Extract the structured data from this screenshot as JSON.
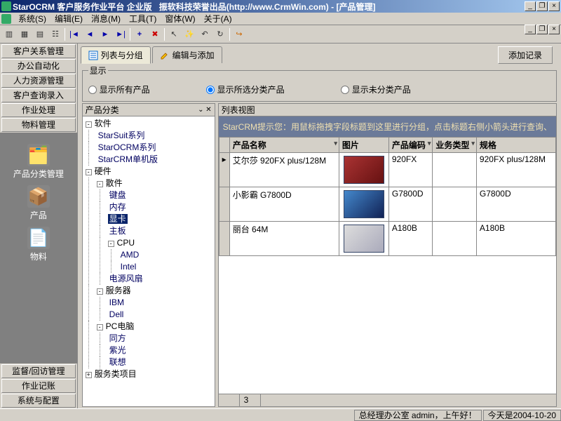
{
  "titlebar": {
    "app": "StarOCRM 客户服务作业平台 企业版",
    "vendor": "振软科技荣誉出品(http://www.CrmWin.com)",
    "doc": "[产品管理]"
  },
  "menus": [
    "系统(S)",
    "编辑(E)",
    "消息(M)",
    "工具(T)",
    "窗体(W)",
    "关于(A)"
  ],
  "sidebar": {
    "top": [
      "客户关系管理",
      "办公自动化",
      "人力资源管理",
      "客户查询录入",
      "作业处理",
      "物料管理"
    ],
    "icons": [
      {
        "label": "产品分类管理",
        "emoji": "🗂️"
      },
      {
        "label": "产品",
        "emoji": "📦"
      },
      {
        "label": "物料",
        "emoji": "📄"
      }
    ],
    "bottom": [
      "监督/回访管理",
      "作业记账",
      "系统与配置"
    ]
  },
  "tabs": {
    "list": "列表与分组",
    "edit": "编辑与添加",
    "add_record": "添加记录"
  },
  "filter": {
    "legend": "显示",
    "all": "显示所有产品",
    "sel": "显示所选分类产品",
    "unsel": "显示未分类产品"
  },
  "tree": {
    "header": "产品分类",
    "nodes": {
      "soft": "软件",
      "starsuit": "StarSuit系列",
      "starocrm": "StarOCRM系列",
      "starcrm": "StarCRM单机版",
      "hard": "硬件",
      "parts": "散件",
      "kb": "键盘",
      "mem": "内存",
      "gpu": "显卡",
      "mb": "主板",
      "cpu": "CPU",
      "amd": "AMD",
      "intel": "Intel",
      "fan": "电源风扇",
      "server": "服务器",
      "ibm": "IBM",
      "dell": "Dell",
      "pc": "PC电脑",
      "tf": "同方",
      "zg": "紫光",
      "lx": "联想",
      "svc": "服务类项目"
    }
  },
  "grid": {
    "header": "列表视图",
    "hint": "StarCRM提示您：用鼠标拖拽字段标题到这里进行分组，点击标题右侧小箭头进行查询、",
    "cols": {
      "name": "产品名称",
      "img": "图片",
      "code": "产品编码",
      "biz": "业务类型",
      "spec": "规格"
    },
    "rows": [
      {
        "name": "艾尔莎 920FX plus/128M",
        "code": "920FX",
        "spec": "920FX plus/128M",
        "img": "red"
      },
      {
        "name": "小影霸 G7800D",
        "code": "G7800D",
        "spec": "G7800D",
        "img": "blue"
      },
      {
        "name": "丽台  64M",
        "code": "A180B",
        "spec": "A180B",
        "img": "white"
      }
    ],
    "count": "3"
  },
  "status": {
    "office": "总经理办公室 admin，上午好！",
    "date": "今天是2004-10-20"
  }
}
